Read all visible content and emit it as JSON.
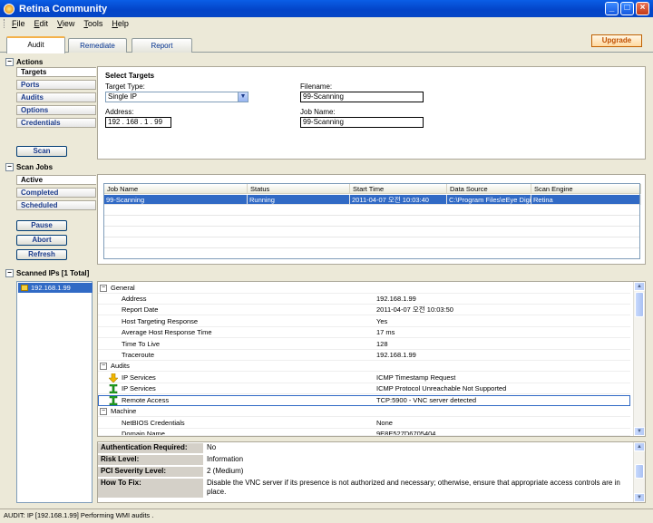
{
  "window": {
    "title": "Retina Community"
  },
  "menu": [
    "File",
    "Edit",
    "View",
    "Tools",
    "Help"
  ],
  "tabs": [
    "Audit",
    "Remediate",
    "Report"
  ],
  "upgrade_label": "Upgrade",
  "actions": {
    "header": "Actions",
    "items": [
      "Targets",
      "Ports",
      "Audits",
      "Options",
      "Credentials"
    ],
    "scan_label": "Scan"
  },
  "targets": {
    "title": "Select Targets",
    "target_type_label": "Target Type:",
    "target_type_value": "Single IP",
    "address_label": "Address:",
    "address_value": "192 . 168 .  1  .  99",
    "filename_label": "Filename:",
    "filename_value": "99-Scanning",
    "jobname_label": "Job Name:",
    "jobname_value": "99-Scanning"
  },
  "scanjobs": {
    "header": "Scan Jobs",
    "items": [
      "Active",
      "Completed",
      "Scheduled"
    ],
    "buttons": [
      "Pause",
      "Abort",
      "Refresh"
    ],
    "columns": [
      "Job Name",
      "Status",
      "Start Time",
      "Data Source",
      "Scan Engine"
    ],
    "rows": [
      [
        "99-Scanning",
        "Running",
        "2011-04-07 오전 10:03:40",
        "C:\\Program Files\\eEye Digi...",
        "Retina"
      ]
    ]
  },
  "scanned": {
    "header": "Scanned IPs [1 Total]",
    "ips": [
      "192.168.1.99"
    ]
  },
  "details": {
    "groups": [
      {
        "name": "General",
        "rows": [
          [
            "Address",
            "192.168.1.99"
          ],
          [
            "Report Date",
            "2011-04-07 오전 10:03:50"
          ],
          [
            "Host Targeting Response",
            "Yes"
          ],
          [
            "Average Host Response Time",
            "17 ms"
          ],
          [
            "Time To Live",
            "128"
          ],
          [
            "Traceroute",
            "192.168.1.99"
          ]
        ]
      },
      {
        "name": "Audits",
        "rows": [
          [
            "IP Services",
            "ICMP Timestamp Request"
          ],
          [
            "IP Services",
            "ICMP Protocol Unreachable Not Supported"
          ],
          [
            "Remote Access",
            "TCP:5900 - VNC server detected"
          ]
        ]
      },
      {
        "name": "Machine",
        "rows": [
          [
            "NetBIOS Credentials",
            "None"
          ],
          [
            "Domain Name",
            "9E8E527D6705404"
          ]
        ]
      }
    ]
  },
  "info": {
    "rows": [
      [
        "Authentication Required:",
        "No"
      ],
      [
        "Risk Level:",
        "Information"
      ],
      [
        "PCI Severity Level:",
        "2 (Medium)"
      ],
      [
        "How To Fix:",
        "Disable the VNC server if its presence is not authorized and necessary; otherwise, ensure that appropriate access controls are in place."
      ]
    ]
  },
  "status": "AUDIT: IP [192.168.1.99] Performing WMI audits ."
}
